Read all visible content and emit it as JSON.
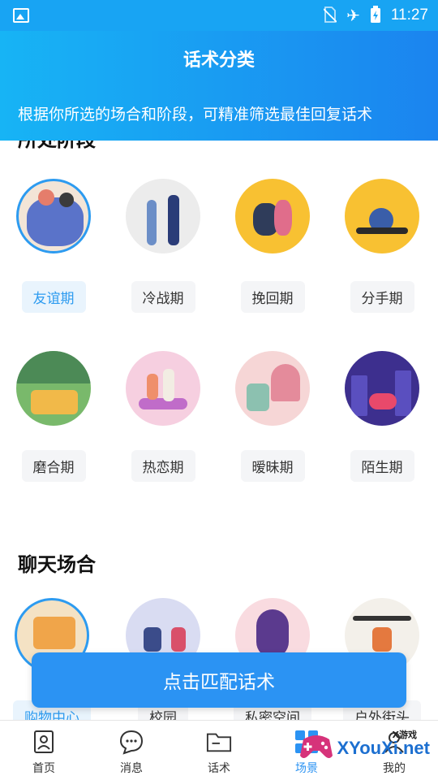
{
  "status_bar": {
    "time": "11:27",
    "icons": [
      "gallery-icon",
      "no-sim-icon",
      "airplane-icon",
      "battery-charging-icon"
    ]
  },
  "header": {
    "title": "话术分类",
    "subtitle": "根据你所选的场合和阶段，可精准筛选最佳回复话术"
  },
  "stage_section": {
    "title": "所处阶段",
    "items": [
      {
        "label": "友谊期",
        "selected": true,
        "icon": "friends-group-illustration"
      },
      {
        "label": "冷战期",
        "selected": false,
        "icon": "couple-standing-illustration"
      },
      {
        "label": "挽回期",
        "selected": false,
        "icon": "kneeling-couple-illustration"
      },
      {
        "label": "分手期",
        "selected": false,
        "icon": "sitting-alone-illustration"
      },
      {
        "label": "磨合期",
        "selected": false,
        "icon": "picnic-illustration"
      },
      {
        "label": "热恋期",
        "selected": false,
        "icon": "dancing-couple-illustration"
      },
      {
        "label": "暧昧期",
        "selected": false,
        "icon": "balcony-guitar-illustration"
      },
      {
        "label": "陌生期",
        "selected": false,
        "icon": "night-city-illustration"
      }
    ]
  },
  "occasion_section": {
    "title": "聊天场合",
    "items": [
      {
        "label": "购物中心",
        "selected": true,
        "icon": "shopping-mall-illustration"
      },
      {
        "label": "校园",
        "selected": false,
        "icon": "campus-illustration"
      },
      {
        "label": "私密空间",
        "selected": false,
        "icon": "private-space-illustration"
      },
      {
        "label": "户外街头",
        "selected": false,
        "icon": "outdoor-street-illustration"
      }
    ]
  },
  "cta": {
    "label": "点击匹配话术"
  },
  "tabbar": {
    "tabs": [
      {
        "label": "首页",
        "icon": "profile-card-icon"
      },
      {
        "label": "消息",
        "icon": "chat-bubble-icon"
      },
      {
        "label": "话术",
        "icon": "folder-icon"
      },
      {
        "label": "场景",
        "icon": "grid-icon"
      },
      {
        "label": "我的",
        "icon": "user-icon"
      }
    ]
  },
  "watermark": {
    "text": "XYouXi.net",
    "small": "X游戏"
  },
  "colors": {
    "accent": "#2b93f3",
    "header_start": "#17b4f5",
    "header_end": "#1b84ef"
  }
}
